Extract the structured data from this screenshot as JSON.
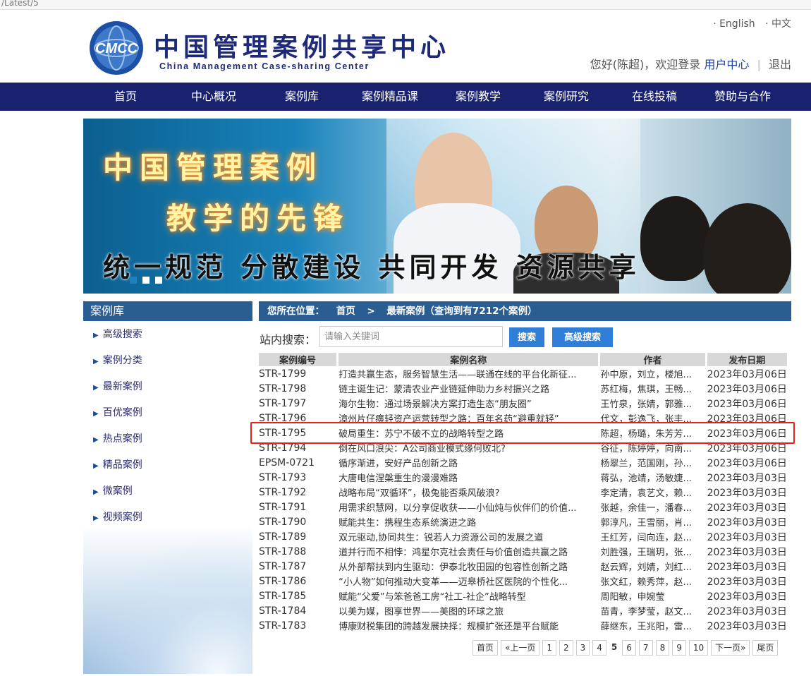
{
  "url_fragment": "/Latest/5",
  "header": {
    "logo_text": "CMCC",
    "title": "中国管理案例共享中心",
    "subtitle": "China Management Case-sharing Center",
    "lang_en": "· English",
    "lang_zh": "· 中文",
    "greeting": "您好(陈超)，欢迎登录",
    "user_center": "用户中心",
    "separator": "|",
    "logout": "退出"
  },
  "nav": [
    "首页",
    "中心概况",
    "案例库",
    "案例精品课",
    "案例教学",
    "案例研究",
    "在线投稿",
    "赞助与合作"
  ],
  "banner": {
    "line1": "中国管理案例",
    "line2": "教学的先锋",
    "line3": "统一规范 分散建设 共同开发 资源共享"
  },
  "sidebar": {
    "title": "案例库",
    "items": [
      "高级搜索",
      "案例分类",
      "最新案例",
      "百优案例",
      "热点案例",
      "精品案例",
      "微案例",
      "视频案例"
    ]
  },
  "breadcrumb": {
    "label": "您所在位置：",
    "home": "首页",
    "arrow": ">",
    "current": "最新案例（查询到有7212个案例）"
  },
  "search": {
    "label": "站内搜索：",
    "placeholder": "请输入关键词",
    "search_button": "搜索",
    "advanced_button": "高级搜索"
  },
  "table": {
    "headers": [
      "案例编号",
      "案例名称",
      "作者",
      "发布日期"
    ],
    "rows": [
      [
        "STR-1799",
        "打造共赢生态，服务智慧生活——联通在线的平台化新征...",
        "孙中原，刘立，楼旭...",
        "2023年03月06日"
      ],
      [
        "STR-1798",
        "链主诞生记：蒙清农业产业链延伸助力乡村振兴之路",
        "苏红梅，焦琪，王畅...",
        "2023年03月06日"
      ],
      [
        "STR-1797",
        "海尔生物：通过场景解决方案打造生态“朋友圈”",
        "王竹泉，张婧，郭雅...",
        "2023年03月06日"
      ],
      [
        "STR-1796",
        "漳州片仔癀轻资产运营转型之路：百年名药“避重就轻”",
        "代文，彭逸飞，张丰...",
        "2023年03月06日"
      ],
      [
        "STR-1795",
        "破局重生：苏宁不破不立的战略转型之路",
        "陈超，杨璐，朱芳芳...",
        "2023年03月06日"
      ],
      [
        "STR-1794",
        "倒在风口浪尖：A公司商业模式缘何败北?",
        "谷征，陈婷婷，向南...",
        "2023年03月06日"
      ],
      [
        "EPSM-0721",
        "循序渐进，安好产品创新之路",
        "杨翠兰，范国刚，孙...",
        "2023年03月06日"
      ],
      [
        "STR-1793",
        "大唐电信涅槃重生的漫漫难路",
        "蒋弘，池靖，汤敏婕...",
        "2023年03月03日"
      ],
      [
        "STR-1792",
        "战略布局“双循环”，极兔能否乘风破浪?",
        "李定清，袁艺文，赖...",
        "2023年03月03日"
      ],
      [
        "STR-1791",
        "用需求织慧网，以分享促收获——小仙炖与伙伴们的价值...",
        "张越，余佳一，潘春...",
        "2023年03月03日"
      ],
      [
        "STR-1790",
        "赋能共生：携程生态系统演进之路",
        "郭淳凡，王雪丽，肖...",
        "2023年03月03日"
      ],
      [
        "STR-1789",
        "双元驱动,协同共生：锐若人力资源公司的发展之道",
        "王红芳，闫向连，赵...",
        "2023年03月03日"
      ],
      [
        "STR-1788",
        "道并行而不相悖：鸿星尔克社会责任与价值创造共赢之路",
        "刘胜强，王瑞玥，张...",
        "2023年03月03日"
      ],
      [
        "STR-1787",
        "从外部帮扶到内生驱动：伊泰北牧田园的包容性创新之路",
        "赵云辉，刘婧，刘红...",
        "2023年03月03日"
      ],
      [
        "STR-1786",
        "“小人物”如何推动大变革——迈皋桥社区医院的个性化...",
        "张文红，赖秀萍，赵...",
        "2023年03月03日"
      ],
      [
        "STR-1785",
        "赋能“父爱”与笨爸爸工房“社工-社企”战略转型",
        "周阳敏，申婉莹",
        "2023年03月03日"
      ],
      [
        "STR-1784",
        "以美为媒，图享世界——美图的环球之旅",
        "苗青，李梦莹，赵文...",
        "2023年03月03日"
      ],
      [
        "STR-1783",
        "博康财税集团的跨越发展抉择：规模扩张还是平台赋能",
        "薛继东，王兆阳，雷...",
        "2023年03月03日"
      ]
    ]
  },
  "pager": [
    "首页",
    "«上一页",
    "1",
    "2",
    "3",
    "4",
    "5",
    "6",
    "7",
    "8",
    "9",
    "10",
    "下一页»",
    "尾页"
  ],
  "pager_current": "5",
  "colors": {
    "nav_bg": "#1a2270",
    "section_bar": "#2a5e93",
    "button": "#2f7fd8",
    "highlight": "#e8201c",
    "title_text": "#1e2a78"
  }
}
